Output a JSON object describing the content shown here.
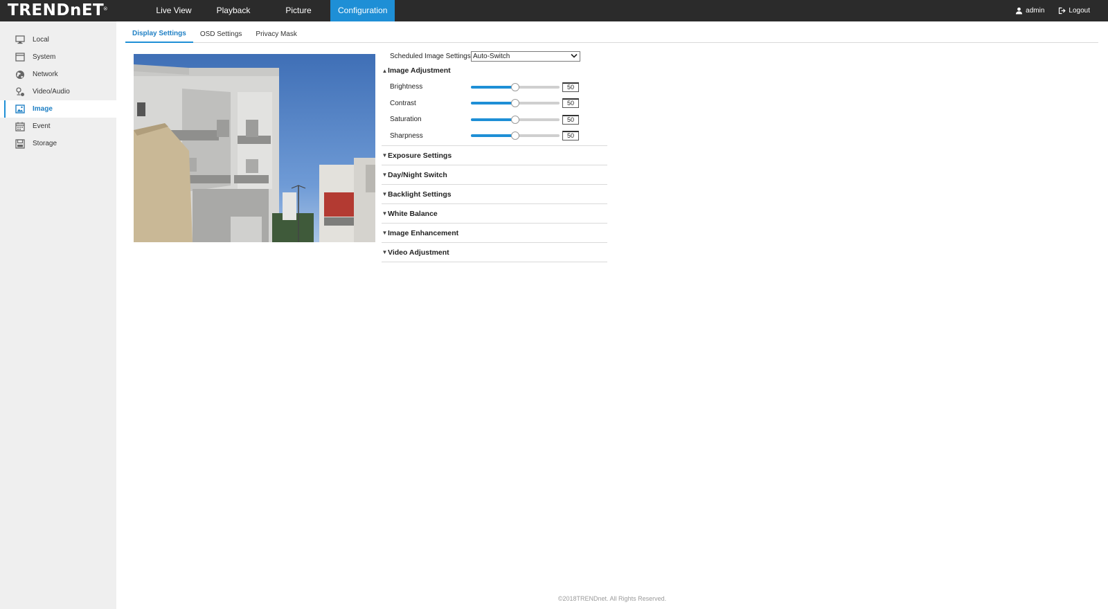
{
  "brand": {
    "logo_text": "TRENDnET",
    "registered": "®"
  },
  "nav": {
    "items": [
      {
        "label": "Live View"
      },
      {
        "label": "Playback"
      },
      {
        "label": "Picture"
      },
      {
        "label": "Configuration"
      }
    ],
    "active_index": 3
  },
  "user": {
    "name": "admin",
    "logout_label": "Logout"
  },
  "sidebar": {
    "items": [
      {
        "label": "Local",
        "icon": "monitor-icon"
      },
      {
        "label": "System",
        "icon": "system-icon"
      },
      {
        "label": "Network",
        "icon": "globe-icon"
      },
      {
        "label": "Video/Audio",
        "icon": "video-audio-icon"
      },
      {
        "label": "Image",
        "icon": "image-icon"
      },
      {
        "label": "Event",
        "icon": "calendar-icon"
      },
      {
        "label": "Storage",
        "icon": "storage-icon"
      }
    ],
    "active_index": 4
  },
  "subtabs": {
    "items": [
      {
        "label": "Display Settings"
      },
      {
        "label": "OSD Settings"
      },
      {
        "label": "Privacy Mask"
      }
    ],
    "active_index": 0
  },
  "settings": {
    "scheduled_label": "Scheduled Image Settings",
    "scheduled_value": "Auto-Switch",
    "image_adjustment": {
      "title": "Image Adjustment",
      "sliders": [
        {
          "label": "Brightness",
          "value": 50,
          "max": 100
        },
        {
          "label": "Contrast",
          "value": 50,
          "max": 100
        },
        {
          "label": "Saturation",
          "value": 50,
          "max": 100
        },
        {
          "label": "Sharpness",
          "value": 50,
          "max": 100
        }
      ]
    },
    "collapsed_sections": [
      "Exposure Settings",
      "Day/Night Switch",
      "Backlight Settings",
      "White Balance",
      "Image Enhancement",
      "Video Adjustment"
    ]
  },
  "colors": {
    "accent": "#1e8fd6",
    "topbar": "#2b2b2b",
    "sidebar": "#efefef"
  },
  "footer": {
    "text": "©2018TRENDnet. All Rights Reserved."
  }
}
